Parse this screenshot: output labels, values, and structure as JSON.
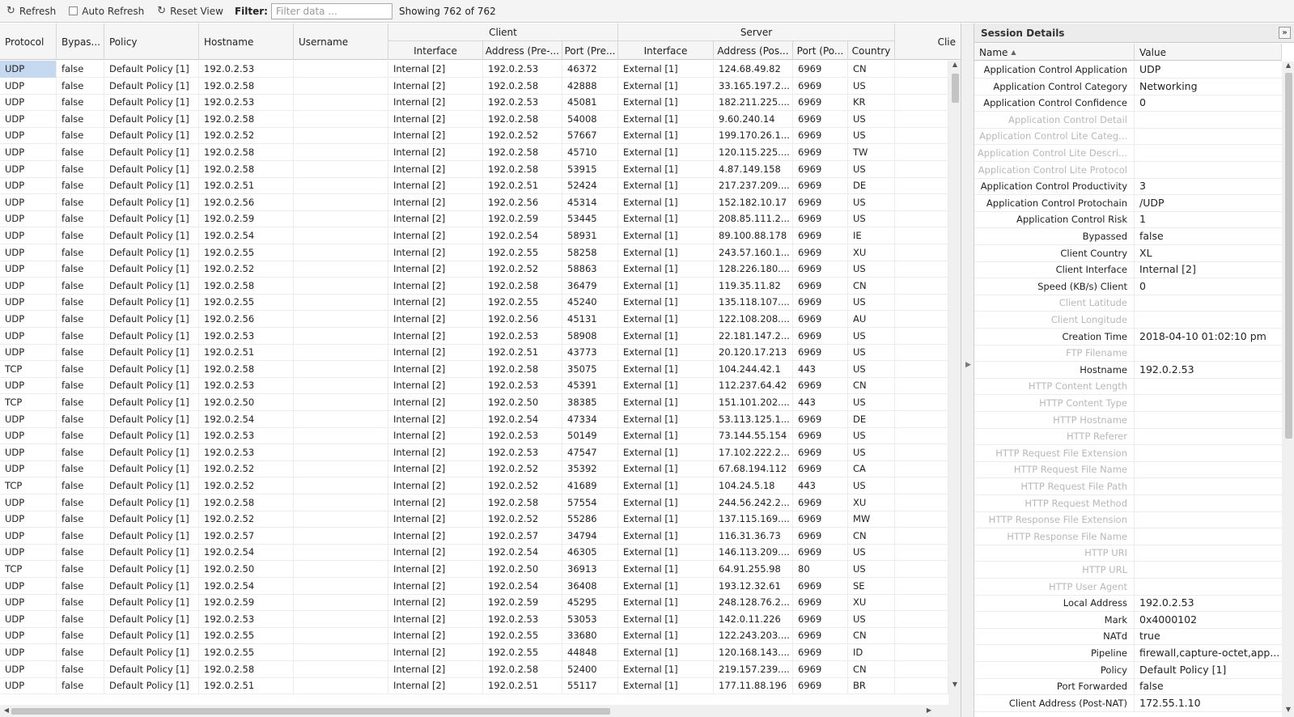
{
  "toolbar": {
    "refresh_label": "Refresh",
    "auto_refresh_label": "Auto Refresh",
    "reset_view_label": "Reset View",
    "filter_label": "Filter:",
    "filter_placeholder": "Filter data ...",
    "count_text": "Showing 762 of 762"
  },
  "grid": {
    "headers": {
      "protocol": "Protocol",
      "bypassed": "Bypas...",
      "policy": "Policy",
      "hostname": "Hostname",
      "username": "Username",
      "client_group": "Client",
      "server_group": "Server",
      "client_interface": "Interface",
      "client_address": "Address (Pre-...",
      "client_port": "Port (Pre...",
      "server_interface": "Interface",
      "server_address": "Address (Pos...",
      "server_port": "Port (Po...",
      "country": "Country",
      "client_extra": "Clie"
    },
    "rows": [
      [
        "UDP",
        "false",
        "Default Policy [1]",
        "192.0.2.53",
        "",
        "Internal [2]",
        "192.0.2.53",
        "46372",
        "External [1]",
        "124.68.49.82",
        "6969",
        "CN"
      ],
      [
        "UDP",
        "false",
        "Default Policy [1]",
        "192.0.2.58",
        "",
        "Internal [2]",
        "192.0.2.58",
        "42888",
        "External [1]",
        "33.165.197.2...",
        "6969",
        "US"
      ],
      [
        "UDP",
        "false",
        "Default Policy [1]",
        "192.0.2.53",
        "",
        "Internal [2]",
        "192.0.2.53",
        "45081",
        "External [1]",
        "182.211.225....",
        "6969",
        "KR"
      ],
      [
        "UDP",
        "false",
        "Default Policy [1]",
        "192.0.2.58",
        "",
        "Internal [2]",
        "192.0.2.58",
        "54008",
        "External [1]",
        "9.60.240.14",
        "6969",
        "US"
      ],
      [
        "UDP",
        "false",
        "Default Policy [1]",
        "192.0.2.52",
        "",
        "Internal [2]",
        "192.0.2.52",
        "57667",
        "External [1]",
        "199.170.26.1...",
        "6969",
        "US"
      ],
      [
        "UDP",
        "false",
        "Default Policy [1]",
        "192.0.2.58",
        "",
        "Internal [2]",
        "192.0.2.58",
        "45710",
        "External [1]",
        "120.115.225....",
        "6969",
        "TW"
      ],
      [
        "UDP",
        "false",
        "Default Policy [1]",
        "192.0.2.58",
        "",
        "Internal [2]",
        "192.0.2.58",
        "53915",
        "External [1]",
        "4.87.149.158",
        "6969",
        "US"
      ],
      [
        "UDP",
        "false",
        "Default Policy [1]",
        "192.0.2.51",
        "",
        "Internal [2]",
        "192.0.2.51",
        "52424",
        "External [1]",
        "217.237.209....",
        "6969",
        "DE"
      ],
      [
        "UDP",
        "false",
        "Default Policy [1]",
        "192.0.2.56",
        "",
        "Internal [2]",
        "192.0.2.56",
        "45314",
        "External [1]",
        "152.182.10.17",
        "6969",
        "US"
      ],
      [
        "UDP",
        "false",
        "Default Policy [1]",
        "192.0.2.59",
        "",
        "Internal [2]",
        "192.0.2.59",
        "53445",
        "External [1]",
        "208.85.111.2...",
        "6969",
        "US"
      ],
      [
        "UDP",
        "false",
        "Default Policy [1]",
        "192.0.2.54",
        "",
        "Internal [2]",
        "192.0.2.54",
        "58931",
        "External [1]",
        "89.100.88.178",
        "6969",
        "IE"
      ],
      [
        "UDP",
        "false",
        "Default Policy [1]",
        "192.0.2.55",
        "",
        "Internal [2]",
        "192.0.2.55",
        "58258",
        "External [1]",
        "243.57.160.1...",
        "6969",
        "XU"
      ],
      [
        "UDP",
        "false",
        "Default Policy [1]",
        "192.0.2.52",
        "",
        "Internal [2]",
        "192.0.2.52",
        "58863",
        "External [1]",
        "128.226.180....",
        "6969",
        "US"
      ],
      [
        "UDP",
        "false",
        "Default Policy [1]",
        "192.0.2.58",
        "",
        "Internal [2]",
        "192.0.2.58",
        "36479",
        "External [1]",
        "119.35.11.82",
        "6969",
        "CN"
      ],
      [
        "UDP",
        "false",
        "Default Policy [1]",
        "192.0.2.55",
        "",
        "Internal [2]",
        "192.0.2.55",
        "45240",
        "External [1]",
        "135.118.107....",
        "6969",
        "US"
      ],
      [
        "UDP",
        "false",
        "Default Policy [1]",
        "192.0.2.56",
        "",
        "Internal [2]",
        "192.0.2.56",
        "45131",
        "External [1]",
        "122.108.208....",
        "6969",
        "AU"
      ],
      [
        "UDP",
        "false",
        "Default Policy [1]",
        "192.0.2.53",
        "",
        "Internal [2]",
        "192.0.2.53",
        "58908",
        "External [1]",
        "22.181.147.2...",
        "6969",
        "US"
      ],
      [
        "UDP",
        "false",
        "Default Policy [1]",
        "192.0.2.51",
        "",
        "Internal [2]",
        "192.0.2.51",
        "43773",
        "External [1]",
        "20.120.17.213",
        "6969",
        "US"
      ],
      [
        "TCP",
        "false",
        "Default Policy [1]",
        "192.0.2.58",
        "",
        "Internal [2]",
        "192.0.2.58",
        "35075",
        "External [1]",
        "104.244.42.1",
        "443",
        "US"
      ],
      [
        "UDP",
        "false",
        "Default Policy [1]",
        "192.0.2.53",
        "",
        "Internal [2]",
        "192.0.2.53",
        "45391",
        "External [1]",
        "112.237.64.42",
        "6969",
        "CN"
      ],
      [
        "TCP",
        "false",
        "Default Policy [1]",
        "192.0.2.50",
        "",
        "Internal [2]",
        "192.0.2.50",
        "38385",
        "External [1]",
        "151.101.202....",
        "443",
        "US"
      ],
      [
        "UDP",
        "false",
        "Default Policy [1]",
        "192.0.2.54",
        "",
        "Internal [2]",
        "192.0.2.54",
        "47334",
        "External [1]",
        "53.113.125.1...",
        "6969",
        "DE"
      ],
      [
        "UDP",
        "false",
        "Default Policy [1]",
        "192.0.2.53",
        "",
        "Internal [2]",
        "192.0.2.53",
        "50149",
        "External [1]",
        "73.144.55.154",
        "6969",
        "US"
      ],
      [
        "UDP",
        "false",
        "Default Policy [1]",
        "192.0.2.53",
        "",
        "Internal [2]",
        "192.0.2.53",
        "47547",
        "External [1]",
        "17.102.222.2...",
        "6969",
        "US"
      ],
      [
        "UDP",
        "false",
        "Default Policy [1]",
        "192.0.2.52",
        "",
        "Internal [2]",
        "192.0.2.52",
        "35392",
        "External [1]",
        "67.68.194.112",
        "6969",
        "CA"
      ],
      [
        "TCP",
        "false",
        "Default Policy [1]",
        "192.0.2.52",
        "",
        "Internal [2]",
        "192.0.2.52",
        "41689",
        "External [1]",
        "104.24.5.18",
        "443",
        "US"
      ],
      [
        "UDP",
        "false",
        "Default Policy [1]",
        "192.0.2.58",
        "",
        "Internal [2]",
        "192.0.2.58",
        "57554",
        "External [1]",
        "244.56.242.2...",
        "6969",
        "XU"
      ],
      [
        "UDP",
        "false",
        "Default Policy [1]",
        "192.0.2.52",
        "",
        "Internal [2]",
        "192.0.2.52",
        "55286",
        "External [1]",
        "137.115.169....",
        "6969",
        "MW"
      ],
      [
        "UDP",
        "false",
        "Default Policy [1]",
        "192.0.2.57",
        "",
        "Internal [2]",
        "192.0.2.57",
        "34794",
        "External [1]",
        "116.31.36.73",
        "6969",
        "CN"
      ],
      [
        "UDP",
        "false",
        "Default Policy [1]",
        "192.0.2.54",
        "",
        "Internal [2]",
        "192.0.2.54",
        "46305",
        "External [1]",
        "146.113.209....",
        "6969",
        "US"
      ],
      [
        "TCP",
        "false",
        "Default Policy [1]",
        "192.0.2.50",
        "",
        "Internal [2]",
        "192.0.2.50",
        "36913",
        "External [1]",
        "64.91.255.98",
        "80",
        "US"
      ],
      [
        "UDP",
        "false",
        "Default Policy [1]",
        "192.0.2.54",
        "",
        "Internal [2]",
        "192.0.2.54",
        "36408",
        "External [1]",
        "193.12.32.61",
        "6969",
        "SE"
      ],
      [
        "UDP",
        "false",
        "Default Policy [1]",
        "192.0.2.59",
        "",
        "Internal [2]",
        "192.0.2.59",
        "45295",
        "External [1]",
        "248.128.76.2...",
        "6969",
        "XU"
      ],
      [
        "UDP",
        "false",
        "Default Policy [1]",
        "192.0.2.53",
        "",
        "Internal [2]",
        "192.0.2.53",
        "53053",
        "External [1]",
        "142.0.11.226",
        "6969",
        "US"
      ],
      [
        "UDP",
        "false",
        "Default Policy [1]",
        "192.0.2.55",
        "",
        "Internal [2]",
        "192.0.2.55",
        "33680",
        "External [1]",
        "122.243.203....",
        "6969",
        "CN"
      ],
      [
        "UDP",
        "false",
        "Default Policy [1]",
        "192.0.2.55",
        "",
        "Internal [2]",
        "192.0.2.55",
        "44848",
        "External [1]",
        "120.168.143....",
        "6969",
        "ID"
      ],
      [
        "UDP",
        "false",
        "Default Policy [1]",
        "192.0.2.58",
        "",
        "Internal [2]",
        "192.0.2.58",
        "52400",
        "External [1]",
        "219.157.239....",
        "6969",
        "CN"
      ],
      [
        "UDP",
        "false",
        "Default Policy [1]",
        "192.0.2.51",
        "",
        "Internal [2]",
        "192.0.2.51",
        "55117",
        "External [1]",
        "177.11.88.196",
        "6969",
        "BR"
      ]
    ]
  },
  "panel": {
    "title": "Session Details",
    "name_header": "Name",
    "value_header": "Value",
    "rows": [
      [
        "Application Control Application",
        "UDP"
      ],
      [
        "Application Control Category",
        "Networking"
      ],
      [
        "Application Control Confidence",
        "0"
      ],
      [
        "Application Control Detail",
        ""
      ],
      [
        "Application Control Lite Categ...",
        ""
      ],
      [
        "Application Control Lite Descri...",
        ""
      ],
      [
        "Application Control Lite Protocol",
        ""
      ],
      [
        "Application Control Productivity",
        "3"
      ],
      [
        "Application Control Protochain",
        "/UDP"
      ],
      [
        "Application Control Risk",
        "1"
      ],
      [
        "Bypassed",
        "false"
      ],
      [
        "Client Country",
        "XL"
      ],
      [
        "Client Interface",
        "Internal [2]"
      ],
      [
        "Speed (KB/s) Client",
        "0"
      ],
      [
        "Client Latitude",
        ""
      ],
      [
        "Client Longitude",
        ""
      ],
      [
        "Creation Time",
        "2018-04-10 01:02:10 pm"
      ],
      [
        "FTP Filename",
        ""
      ],
      [
        "Hostname",
        "192.0.2.53"
      ],
      [
        "HTTP Content Length",
        ""
      ],
      [
        "HTTP Content Type",
        ""
      ],
      [
        "HTTP Hostname",
        ""
      ],
      [
        "HTTP Referer",
        ""
      ],
      [
        "HTTP Request File Extension",
        ""
      ],
      [
        "HTTP Request File Name",
        ""
      ],
      [
        "HTTP Request File Path",
        ""
      ],
      [
        "HTTP Request Method",
        ""
      ],
      [
        "HTTP Response File Extension",
        ""
      ],
      [
        "HTTP Response File Name",
        ""
      ],
      [
        "HTTP URI",
        ""
      ],
      [
        "HTTP URL",
        ""
      ],
      [
        "HTTP User Agent",
        ""
      ],
      [
        "Local Address",
        "192.0.2.53"
      ],
      [
        "Mark",
        "0x4000102"
      ],
      [
        "NATd",
        "true"
      ],
      [
        "Pipeline",
        "firewall,capture-octet,app..."
      ],
      [
        "Policy",
        "Default Policy [1]"
      ],
      [
        "Port Forwarded",
        "false"
      ],
      [
        "Client Address (Post-NAT)",
        "172.55.1.10"
      ]
    ]
  }
}
